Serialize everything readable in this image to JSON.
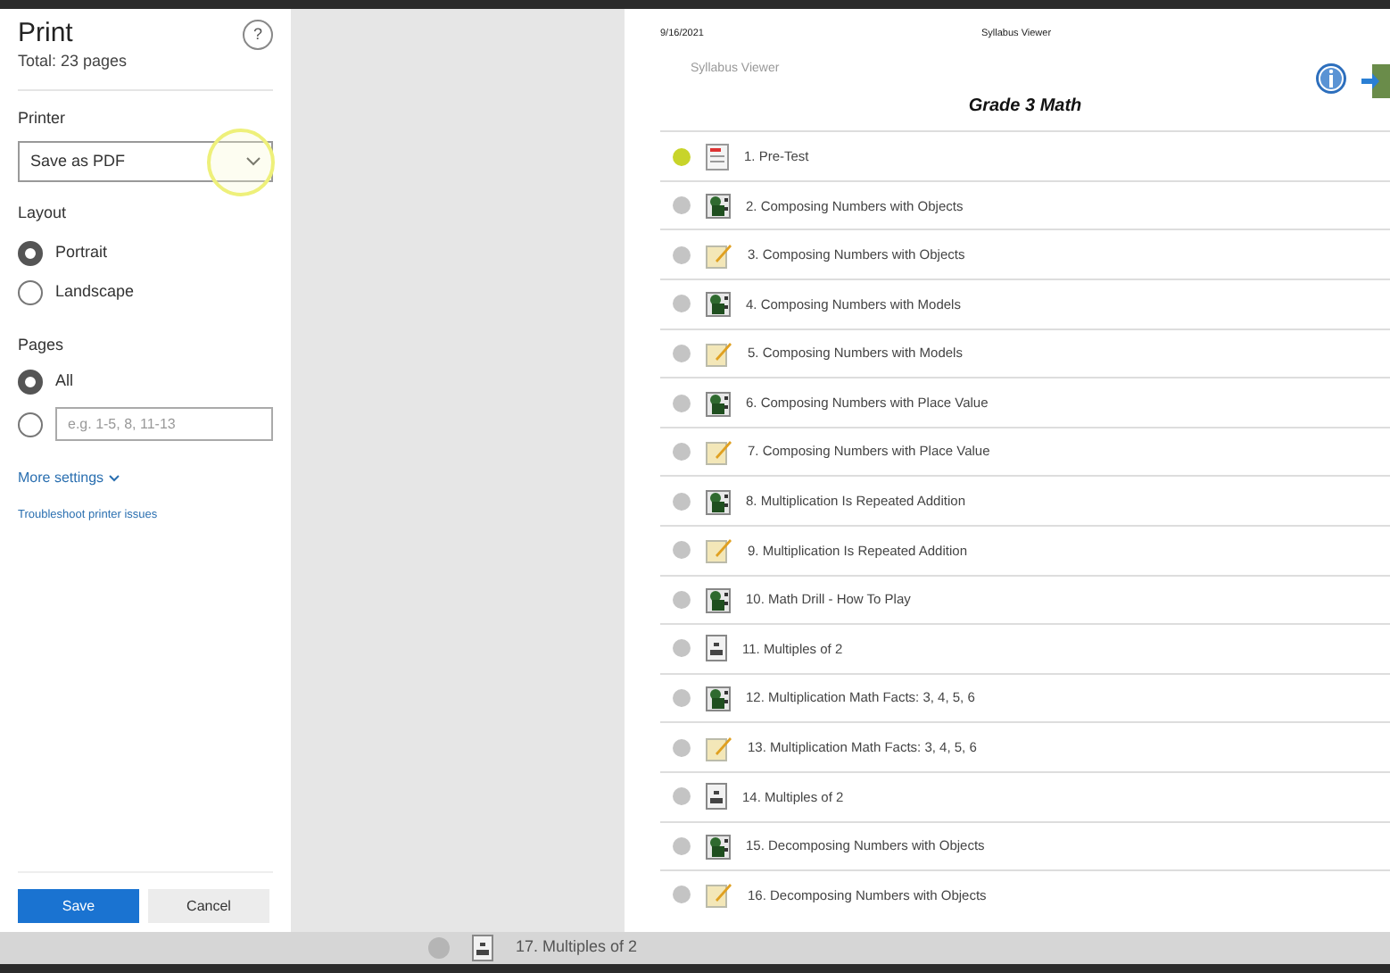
{
  "print_panel": {
    "title": "Print",
    "subtitle": "Total: 23 pages",
    "help": "?",
    "printer": {
      "label": "Printer",
      "value": "Save as PDF"
    },
    "layout": {
      "label": "Layout",
      "options": [
        {
          "label": "Portrait",
          "selected": true
        },
        {
          "label": "Landscape",
          "selected": false
        }
      ]
    },
    "pages": {
      "label": "Pages",
      "options": [
        {
          "label": "All",
          "selected": true
        },
        {
          "placeholder": "e.g. 1-5, 8, 11-13",
          "selected": false
        }
      ]
    },
    "more_settings": "More settings",
    "troubleshoot": "Troubleshoot printer issues",
    "buttons": [
      {
        "label": "Save",
        "kind": "primary"
      },
      {
        "label": "Cancel",
        "kind": "secondary"
      }
    ]
  },
  "preview": {
    "date": "9/16/2021",
    "header": "Syllabus Viewer",
    "app_name": "Syllabus Viewer",
    "course_title": "Grade 3 Math",
    "items": [
      {
        "label": "1. Pre-Test",
        "kind": "test",
        "color": "#c8d42a"
      },
      {
        "label": "2. Composing Numbers with Objects",
        "kind": "video",
        "color": "#c4c4c4"
      },
      {
        "label": "3. Composing Numbers with Objects",
        "kind": "pencil",
        "color": "#c4c4c4"
      },
      {
        "label": "4. Composing Numbers with Models",
        "kind": "video",
        "color": "#c4c4c4"
      },
      {
        "label": "5. Composing Numbers with Models",
        "kind": "pencil",
        "color": "#c4c4c4"
      },
      {
        "label": "6. Composing Numbers with Place Value",
        "kind": "video",
        "color": "#c4c4c4"
      },
      {
        "label": "7. Composing Numbers with Place Value",
        "kind": "pencil",
        "color": "#c4c4c4"
      },
      {
        "label": "8. Multiplication Is Repeated Addition",
        "kind": "video",
        "color": "#c4c4c4"
      },
      {
        "label": "9. Multiplication Is Repeated Addition",
        "kind": "pencil",
        "color": "#c4c4c4"
      },
      {
        "label": "10. Math Drill - How To Play",
        "kind": "video",
        "color": "#c4c4c4"
      },
      {
        "label": "11. Multiples of 2",
        "kind": "doc",
        "color": "#c4c4c4"
      },
      {
        "label": "12. Multiplication Math Facts: 3, 4, 5, 6",
        "kind": "video",
        "color": "#c4c4c4"
      },
      {
        "label": "13. Multiplication Math Facts: 3, 4, 5, 6",
        "kind": "pencil",
        "color": "#c4c4c4"
      },
      {
        "label": "14. Multiples of 2",
        "kind": "doc",
        "color": "#c4c4c4"
      },
      {
        "label": "15. Decomposing Numbers with Objects",
        "kind": "video",
        "color": "#c4c4c4"
      },
      {
        "label": "16. Decomposing Numbers with Objects",
        "kind": "pencil",
        "color": "#c4c4c4"
      }
    ]
  },
  "background_item": {
    "label": "17. Multiples of 2",
    "kind": "doc"
  }
}
